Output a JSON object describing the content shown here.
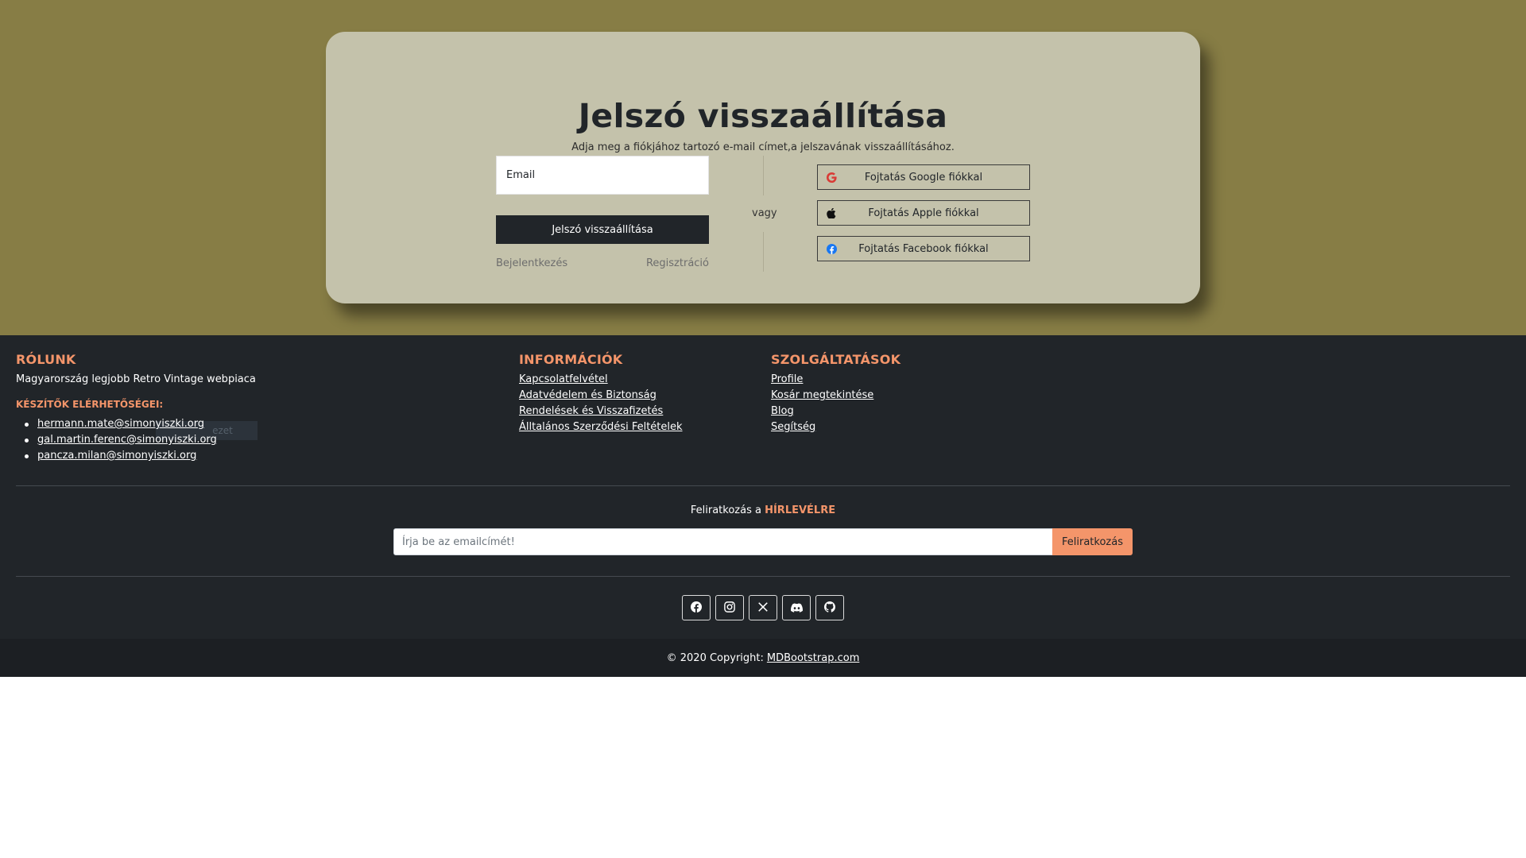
{
  "reset": {
    "title": "Jelszó visszaállítása",
    "subtitle": "Adja meg a fiókjához tartozó e-mail címet,a jelszavának visszaállításához.",
    "email_placeholder": "Email",
    "submit_label": "Jelszó visszaállítása",
    "login_link": "Bejelentkezés",
    "register_link": "Regisztráció",
    "or_label": "vagy",
    "google_label": "Fojtatás Google fiókkal",
    "apple_label": "Fojtatás Apple fiókkal",
    "facebook_label": "Fojtatás Facebook fiókkal"
  },
  "footer": {
    "about": {
      "heading": "RÓLUNK",
      "text": "Magyarország legjobb Retro Vintage webpiaca",
      "contacts_heading": "KÉSZÍTŐK ELÉRHETŐSÉGEI:",
      "emails": [
        "hermann.mate@simonyiszki.org",
        "gal.martin.ferenc@simonyiszki.org",
        "pancza.milan@simonyiszki.org"
      ],
      "ghost_text": "ezet"
    },
    "info": {
      "heading": "INFORMÁCIÓK",
      "links": [
        "Kapcsolatfelvétel",
        "Adatvédelem és Biztonság",
        "Rendelések és Visszafizetés",
        "Álltalános Szerződési Feltételek"
      ]
    },
    "services": {
      "heading": "SZOLGÁLTATÁSOK",
      "links": [
        "Profile",
        "Kosár megtekintése",
        "Blog",
        "Segítség"
      ]
    },
    "newsletter": {
      "label_prefix": "Feliratkozás a",
      "label_accent": "HÍRLEVÉLRE",
      "placeholder": "Írja be az emailcímét!",
      "button": "Feliratkozás"
    },
    "social_icons": [
      "facebook-icon",
      "instagram-icon",
      "x-icon",
      "discord-icon",
      "github-icon"
    ],
    "copyright_prefix": "© 2020 Copyright:",
    "copyright_link": "MDBootstrap.com"
  },
  "colors": {
    "hero_bg": "#877d45",
    "card_bg": "#c4c2ab",
    "footer_bg": "#212529",
    "accent": "#f4956a"
  }
}
